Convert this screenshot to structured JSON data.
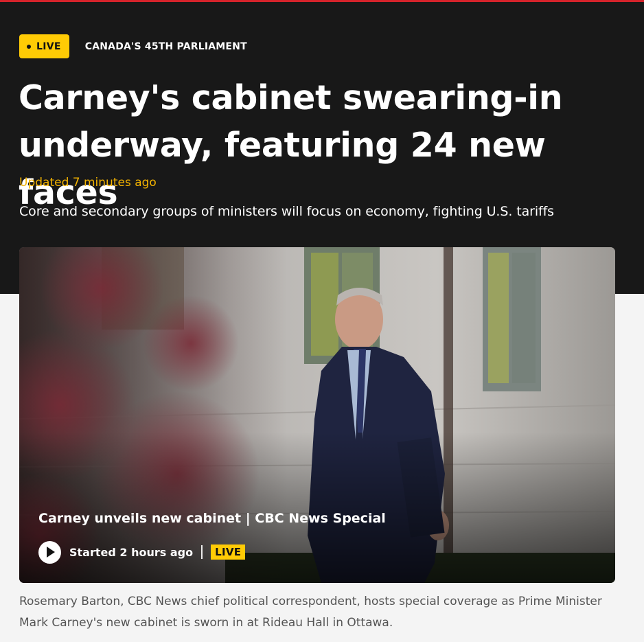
{
  "kicker": {
    "live_label": "LIVE",
    "section": "CANADA'S 45TH PARLIAMENT"
  },
  "headline": "Carney's cabinet swearing-in underway, featuring 24 new faces",
  "updated": "Updated 7 minutes ago",
  "deck": "Core and secondary groups of ministers will focus on economy, fighting U.S. tariffs",
  "video": {
    "title": "Carney unveils new cabinet | CBC News Special",
    "started": "Started 2 hours ago",
    "live_badge": "LIVE"
  },
  "caption": "Rosemary Barton, CBC News chief political correspondent, hosts special coverage as Prime Minister Mark Carney's new cabinet is sworn in at Rideau Hall in Ottawa.",
  "colors": {
    "accent_yellow": "#ffcb05",
    "updated_text": "#f5b400",
    "top_rule": "#d5232b",
    "hero_background": "#181818"
  },
  "icons": {
    "live_dot": "dot-icon",
    "play": "play-icon"
  }
}
